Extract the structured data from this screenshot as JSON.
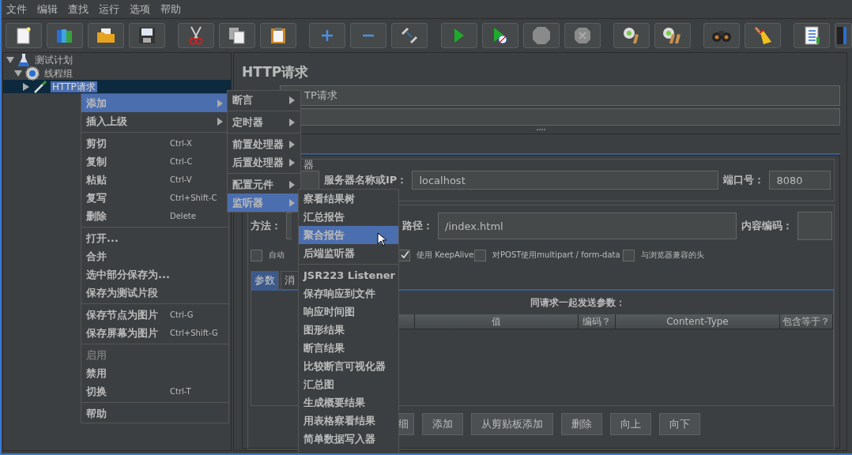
{
  "menu_bar": [
    "文件",
    "编辑",
    "查找",
    "运行",
    "选项",
    "帮助"
  ],
  "tree": [
    {
      "label": "测试计划",
      "kind": "plan",
      "expanded": true,
      "selected": false,
      "children": [
        {
          "label": "线程组",
          "kind": "group",
          "expanded": true,
          "selected": false,
          "children": [
            {
              "label": "HTTP请求",
              "kind": "sampler",
              "expanded": false,
              "selected": true
            }
          ]
        }
      ]
    }
  ],
  "context_menu": [
    [
      {
        "label": "添加",
        "submenu": true,
        "selected": true,
        "disabled": false
      },
      {
        "label": "插入上级",
        "submenu": true,
        "selected": false,
        "disabled": false
      }
    ],
    [
      {
        "label": "剪切",
        "shortcut": "Ctrl-X",
        "selected": false,
        "disabled": false
      },
      {
        "label": "复制",
        "shortcut": "Ctrl-C",
        "selected": false,
        "disabled": false
      },
      {
        "label": "粘贴",
        "shortcut": "Ctrl-V",
        "selected": false,
        "disabled": false
      },
      {
        "label": "复写",
        "shortcut": "Ctrl+Shift-C",
        "selected": false,
        "disabled": false
      },
      {
        "label": "删除",
        "shortcut": "Delete",
        "selected": false,
        "disabled": false
      }
    ],
    [
      {
        "label": "打开...",
        "selected": false,
        "disabled": false
      },
      {
        "label": "合并",
        "selected": false,
        "disabled": false
      },
      {
        "label": "选中部分保存为...",
        "selected": false,
        "disabled": false
      },
      {
        "label": "保存为测试片段",
        "selected": false,
        "disabled": false
      }
    ],
    [
      {
        "label": "保存节点为图片",
        "shortcut": "Ctrl-G",
        "selected": false,
        "disabled": false
      },
      {
        "label": "保存屏幕为图片",
        "shortcut": "Ctrl+Shift-G",
        "selected": false,
        "disabled": false
      }
    ],
    [
      {
        "label": "启用",
        "selected": false,
        "disabled": true
      },
      {
        "label": "禁用",
        "selected": false,
        "disabled": false
      },
      {
        "label": "切换",
        "shortcut": "Ctrl-T",
        "selected": false,
        "disabled": false
      }
    ],
    [
      {
        "label": "帮助",
        "selected": false,
        "disabled": false
      }
    ]
  ],
  "add_submenu": [
    [
      {
        "label": "断言",
        "submenu": true,
        "selected": false
      }
    ],
    [
      {
        "label": "定时器",
        "submenu": true,
        "selected": false
      }
    ],
    [
      {
        "label": "前置处理器",
        "submenu": true,
        "selected": false
      },
      {
        "label": "后置处理器",
        "submenu": true,
        "selected": false
      }
    ],
    [
      {
        "label": "配置元件",
        "submenu": true,
        "selected": false
      },
      {
        "label": "监听器",
        "submenu": true,
        "selected": true
      }
    ]
  ],
  "listener_submenu": [
    [
      {
        "label": "察看结果树",
        "selected": false
      },
      {
        "label": "汇总报告",
        "selected": false
      },
      {
        "label": "聚合报告",
        "selected": true
      },
      {
        "label": "后端监听器",
        "selected": false
      }
    ],
    [
      {
        "label": "JSR223 Listener",
        "selected": false
      },
      {
        "label": "保存响应到文件",
        "selected": false
      },
      {
        "label": "响应时间图",
        "selected": false
      },
      {
        "label": "图形结果",
        "selected": false
      },
      {
        "label": "断言结果",
        "selected": false
      },
      {
        "label": "比较断言可视化器",
        "selected": false
      },
      {
        "label": "汇总图",
        "selected": false
      },
      {
        "label": "生成概要结果",
        "selected": false
      },
      {
        "label": "用表格察看结果",
        "selected": false
      },
      {
        "label": "简单数据写入器",
        "selected": false
      }
    ]
  ],
  "editor": {
    "title": "HTTP请求",
    "name_value": "TP请求",
    "web_server": {
      "title": "器",
      "server_label": "服务器名称或IP：",
      "server_value": "localhost",
      "port_label": "端口号：",
      "port_value": "8080"
    },
    "request": {
      "method_label": "方法：",
      "path_label": "路径：",
      "path_value": "/index.html",
      "encoding_label": "内容编码："
    },
    "options": [
      {
        "label": "自动",
        "checked": false
      },
      {
        "label": "使用 KeepAlive",
        "checked": true
      },
      {
        "label": "对POST使用multipart / form-data",
        "checked": false
      },
      {
        "label": "与浏览器兼容的头",
        "checked": false
      }
    ],
    "tabs": [
      {
        "label": "参数",
        "selected": true
      },
      {
        "label": "消",
        "selected": false
      }
    ],
    "params": {
      "title": "同请求一起发送参数：",
      "columns": [
        "值",
        "编码？",
        "Content-Type",
        "包含等于？"
      ]
    },
    "buttons": [
      "细",
      "添加",
      "从剪贴板添加",
      "删除",
      "向上",
      "向下"
    ]
  }
}
